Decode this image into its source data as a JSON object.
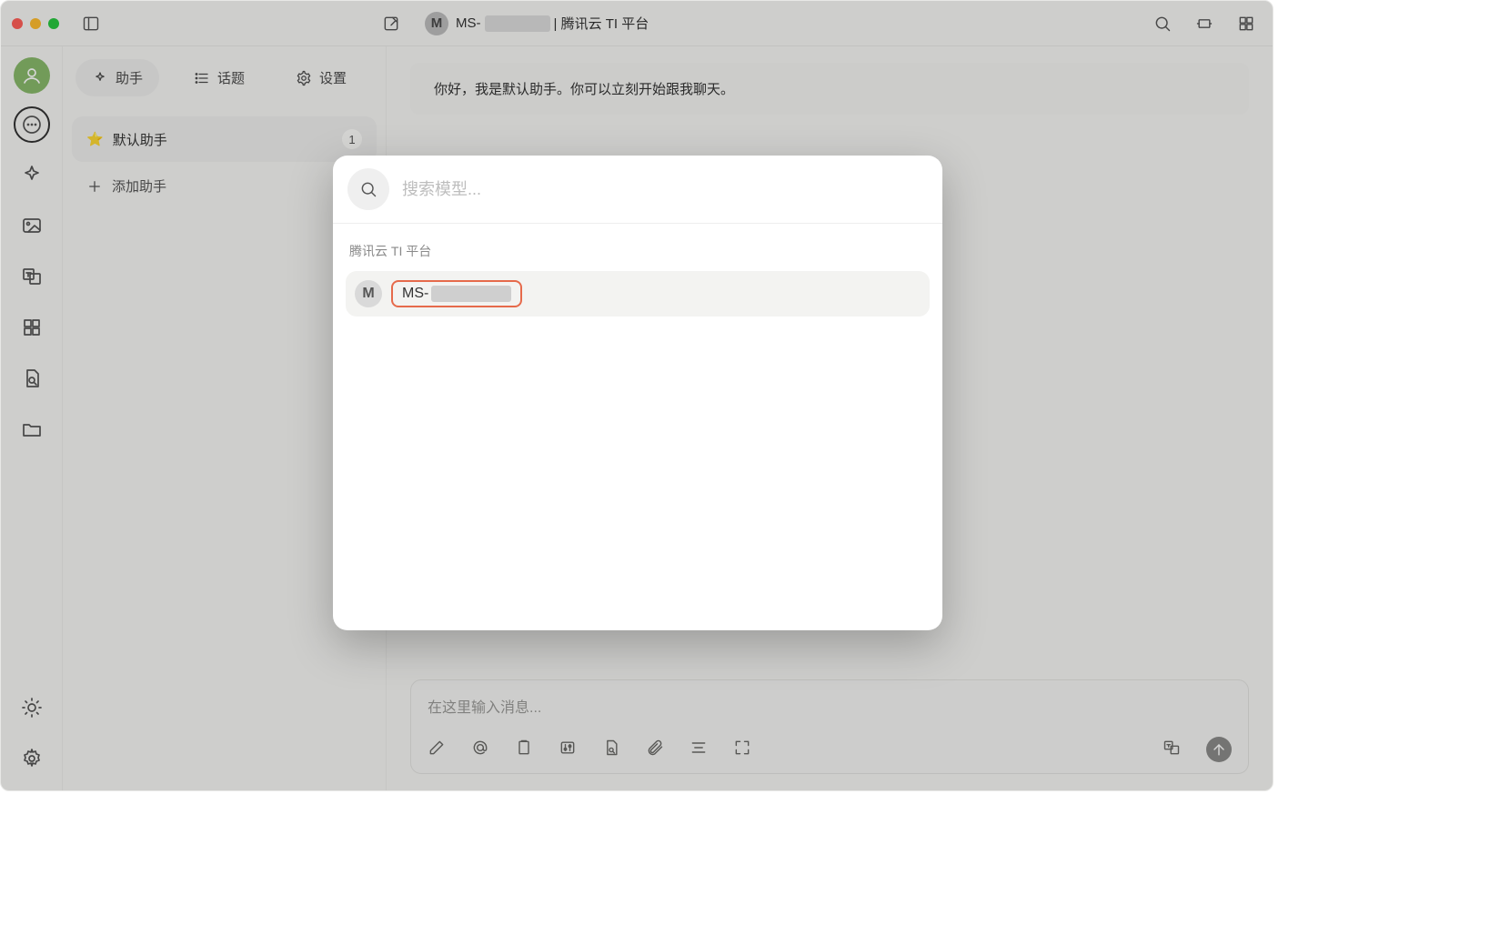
{
  "titlebar": {
    "model_badge_letter": "M",
    "title_prefix": "MS-",
    "title_suffix": " | 腾讯云 TI 平台"
  },
  "side_tabs": {
    "assistant": "助手",
    "topics": "话题",
    "settings": "设置"
  },
  "assistants": {
    "items": [
      {
        "label": "默认助手",
        "count": "1"
      }
    ],
    "add_label": "添加助手"
  },
  "chat": {
    "greeting": "你好，我是默认助手。你可以立刻开始跟我聊天。",
    "input_placeholder": "在这里输入消息..."
  },
  "modal": {
    "search_placeholder": "搜索模型...",
    "group_label": "腾讯云 TI 平台",
    "items": [
      {
        "badge": "M",
        "name_prefix": "MS-"
      }
    ]
  }
}
